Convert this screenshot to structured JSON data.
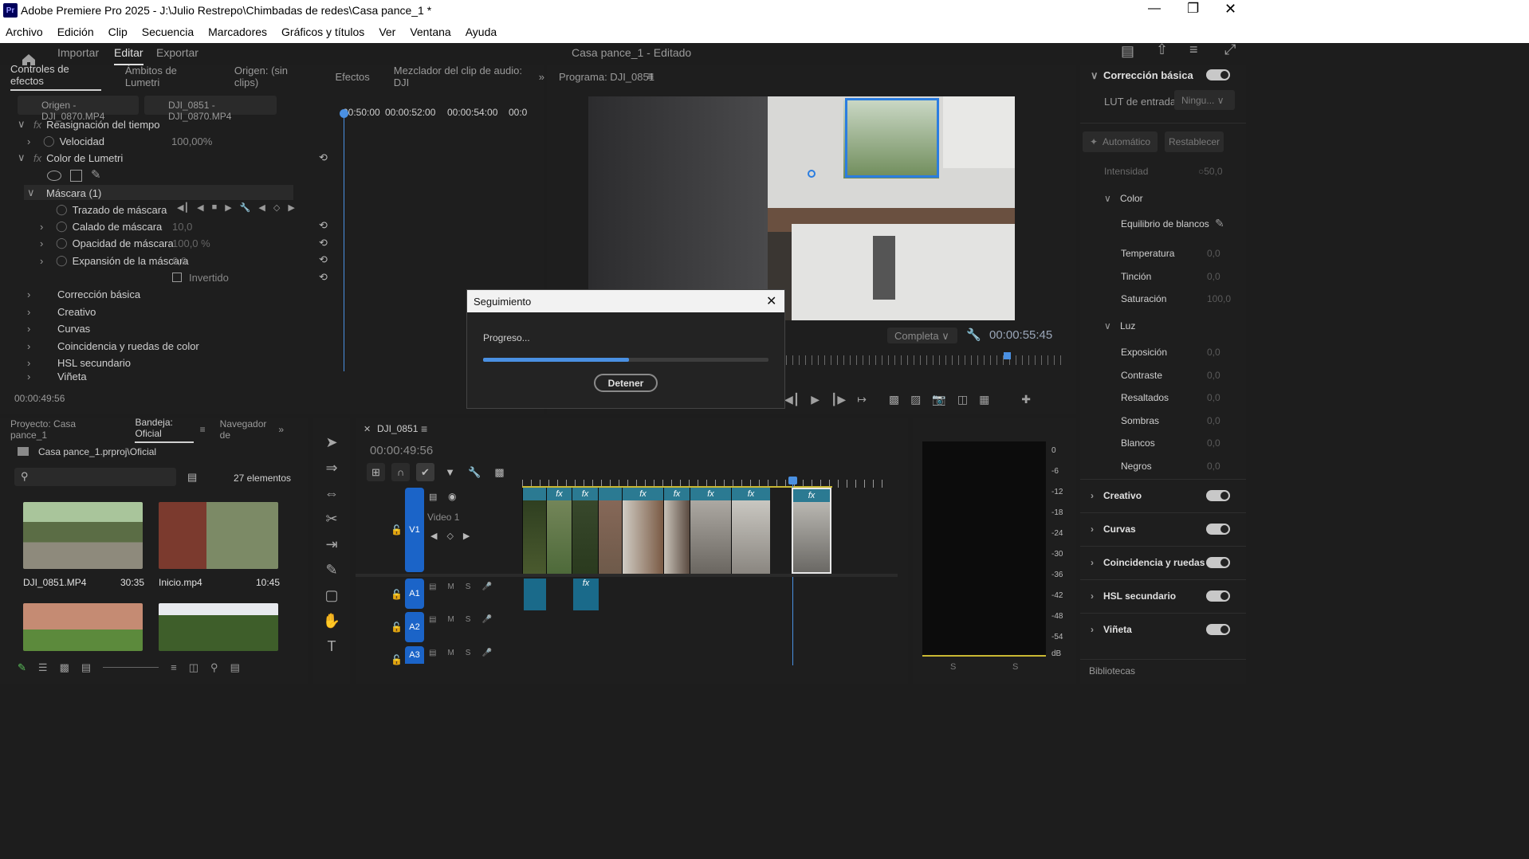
{
  "window": {
    "title": "Adobe Premiere Pro 2025 - J:\\Julio Restrepo\\Chimbadas de redes\\Casa pance_1 *",
    "app_icon": "Pr"
  },
  "menu": [
    "Archivo",
    "Edición",
    "Clip",
    "Secuencia",
    "Marcadores",
    "Gráficos y títulos",
    "Ver",
    "Ventana",
    "Ayuda"
  ],
  "workspace": {
    "tabs": [
      "Importar",
      "Editar",
      "Exportar"
    ],
    "active_tab": "Editar",
    "project_title": "Casa pance_1 - Editado"
  },
  "effect_controls": {
    "tabs": [
      "Controles de efectos",
      "Ámbitos de Lumetri",
      "Origen: (sin clips)",
      "Efectos",
      "Mezclador del clip de audio: DJI"
    ],
    "source_label": "Origen - DJI_0870.MP4",
    "seq_label": "DJI_0851 - DJI_0870.MP4",
    "ruler_times": [
      "00:50:00",
      "00:00:52:00",
      "00:00:54:00",
      "00:0"
    ],
    "time_remap": "Reasignación del tiempo",
    "speed_label": "Velocidad",
    "speed_value": "100,00%",
    "lumetri": "Color de Lumetri",
    "mask": "Máscara (1)",
    "mask_path": "Trazado de máscara",
    "feather_label": "Calado de máscara",
    "feather_value": "10,0",
    "opacity_label": "Opacidad de máscara",
    "opacity_value": "100,0 %",
    "expansion_label": "Expansión de la máscara",
    "expansion_value": "0,0",
    "inverted": "Invertido",
    "sections": [
      "Corrección básica",
      "Creativo",
      "Curvas",
      "Coincidencia y ruedas de color",
      "HSL secundario",
      "Viñeta"
    ],
    "timecode": "00:00:49:56"
  },
  "program": {
    "label": "Programa: DJI_0851",
    "quality": "Completa",
    "timecode": "00:00:55:45"
  },
  "dialog": {
    "title": "Seguimiento",
    "progress_label": "Progreso...",
    "progress": 0.51,
    "stop_button": "Detener"
  },
  "project": {
    "tabs": [
      "Proyecto: Casa pance_1",
      "Bandeja: Oficial",
      "Navegador de"
    ],
    "path": "Casa pance_1.prproj\\Oficial",
    "count": "27 elementos",
    "items": [
      {
        "name": "DJI_0851.MP4",
        "duration": "30:35"
      },
      {
        "name": "Inicio.mp4",
        "duration": "10:45"
      },
      {
        "name": "",
        "duration": ""
      },
      {
        "name": "",
        "duration": ""
      }
    ]
  },
  "timeline": {
    "tab": "DJI_0851",
    "timecode": "00:00:49:56",
    "tracks": {
      "v1": "V1",
      "v1_name": "Video 1",
      "a1": "A1",
      "a2": "A2",
      "a3": "A3",
      "m": "M",
      "s": "S"
    },
    "fx": "fx"
  },
  "audio_meter": {
    "scale": [
      "0",
      "-6",
      "-12",
      "-18",
      "-24",
      "-30",
      "-36",
      "-42",
      "-48",
      "-54",
      "dB"
    ],
    "channels": [
      "S",
      "S"
    ]
  },
  "lumetri_panel": {
    "basic": "Corrección básica",
    "lut_label": "LUT de entrada",
    "lut_value": "Ningu...",
    "auto": "Automático",
    "reset": "Restablecer",
    "intensity_label": "Intensidad",
    "intensity_value": "50,0",
    "color": "Color",
    "wb": "Equilibrio de blancos",
    "temperature": "Temperatura",
    "tint": "Tinción",
    "saturation": "Saturación",
    "light": "Luz",
    "exposure": "Exposición",
    "contrast": "Contraste",
    "highlights": "Resaltados",
    "shadows": "Sombras",
    "whites": "Blancos",
    "blacks": "Negros",
    "zero": "0,0",
    "hundred": "100,0",
    "creative": "Creativo",
    "curves": "Curvas",
    "wheels": "Coincidencia y ruedas de color",
    "hsl": "HSL secundario",
    "vignette": "Viñeta",
    "libraries": "Bibliotecas"
  }
}
